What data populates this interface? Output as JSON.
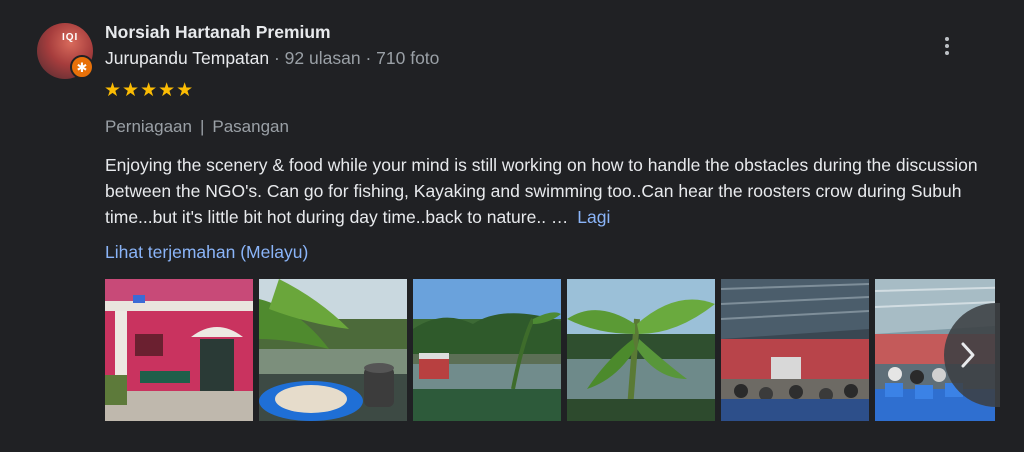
{
  "reviewer": {
    "name": "Norsiah Hartanah Premium",
    "avatar_logo": "IQI",
    "badge": "Jurupandu Tempatan",
    "reviews_count": "· 92 ulasan",
    "photos_count": "· 710 foto"
  },
  "rating": {
    "value": 5,
    "max": 5,
    "stars": "★★★★★"
  },
  "tags": [
    "Perniagaan",
    "Pasangan"
  ],
  "tag_separator": "|",
  "review_text": "Enjoying the scenery & food while your mind is still working on how to handle the obstacles  during the discussion between the NGO's. Can go for fishing,  Kayaking and swimming too..Can hear the roosters crow during Subuh time...but it's little bit hot during day time..back to nature.. …",
  "more_label": "Lagi",
  "translate_label": "Lihat terjemahan (Melayu)",
  "photos": [
    {
      "subject": "pink building with chairs"
    },
    {
      "subject": "banana leaves and plate of food by lake"
    },
    {
      "subject": "lake with trees and boat"
    },
    {
      "subject": "banana tree by lake"
    },
    {
      "subject": "hall with people in meeting"
    },
    {
      "subject": "hall with blue chairs"
    }
  ],
  "icons": {
    "more": "more-vert-icon",
    "next": "chevron-right-icon",
    "guide": "local-guide-star-icon"
  },
  "colors": {
    "background": "#202124",
    "star": "#fbbc04",
    "link": "#8ab4f8",
    "secondary_text": "#9aa0a6",
    "guide_badge": "#e8710a"
  }
}
